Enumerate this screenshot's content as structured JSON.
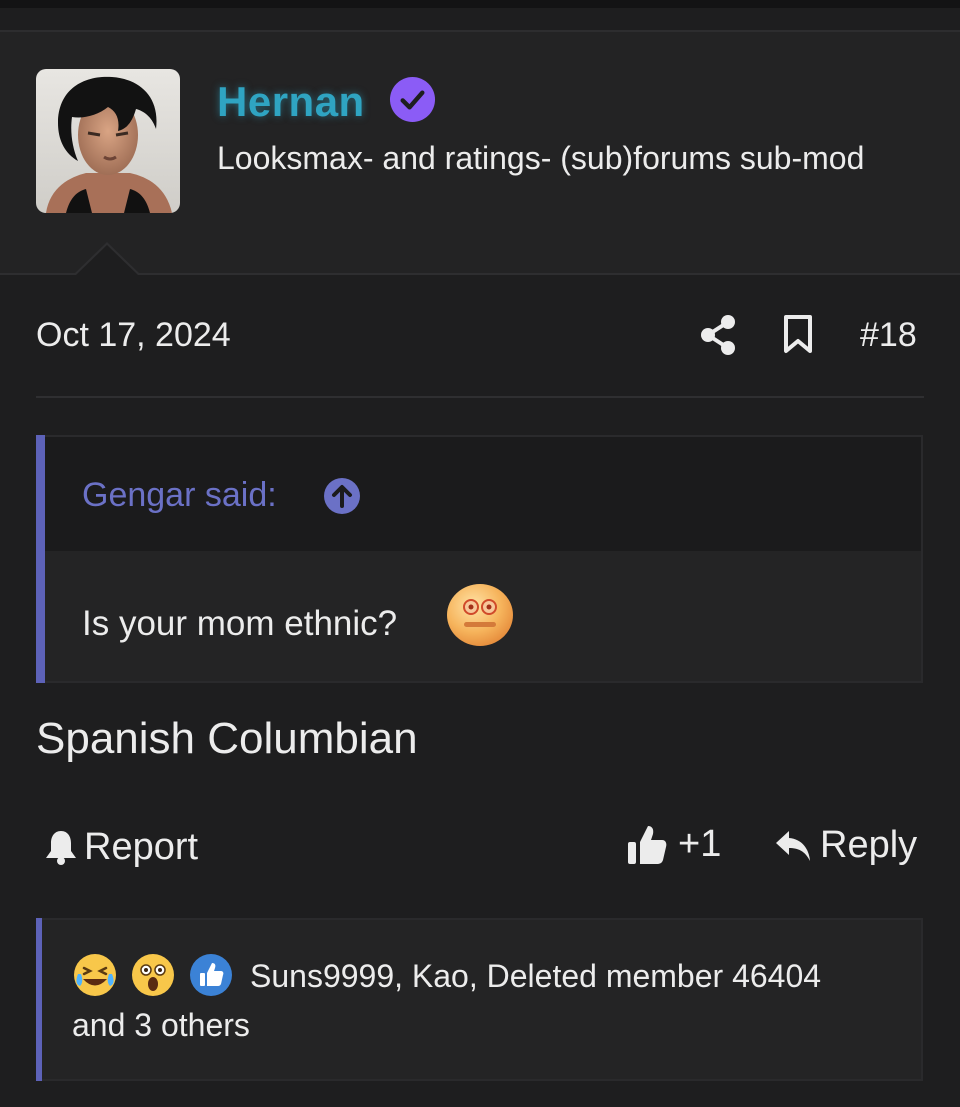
{
  "post": {
    "username": "Hernan",
    "user_title": "Looksmax- and ratings- (sub)forums sub-mod",
    "date": "Oct 17, 2024",
    "post_number": "#18",
    "body": "Spanish Columbian"
  },
  "quote": {
    "author": "Gengar said:",
    "text": "Is your mom ethnic?"
  },
  "actions": {
    "report": "Report",
    "like_count": "+1",
    "reply": "Reply"
  },
  "reactions": {
    "text": "Suns9999, Kao, Deleted member 46404 and 3 others",
    "icons": [
      "laughing-crying-icon",
      "shocked-face-icon",
      "like-icon"
    ]
  },
  "colors": {
    "username": "#2fa4c2",
    "verified": "#8b5cf6",
    "quote_accent": "#5d62b8",
    "background": "#1e1e1f"
  }
}
